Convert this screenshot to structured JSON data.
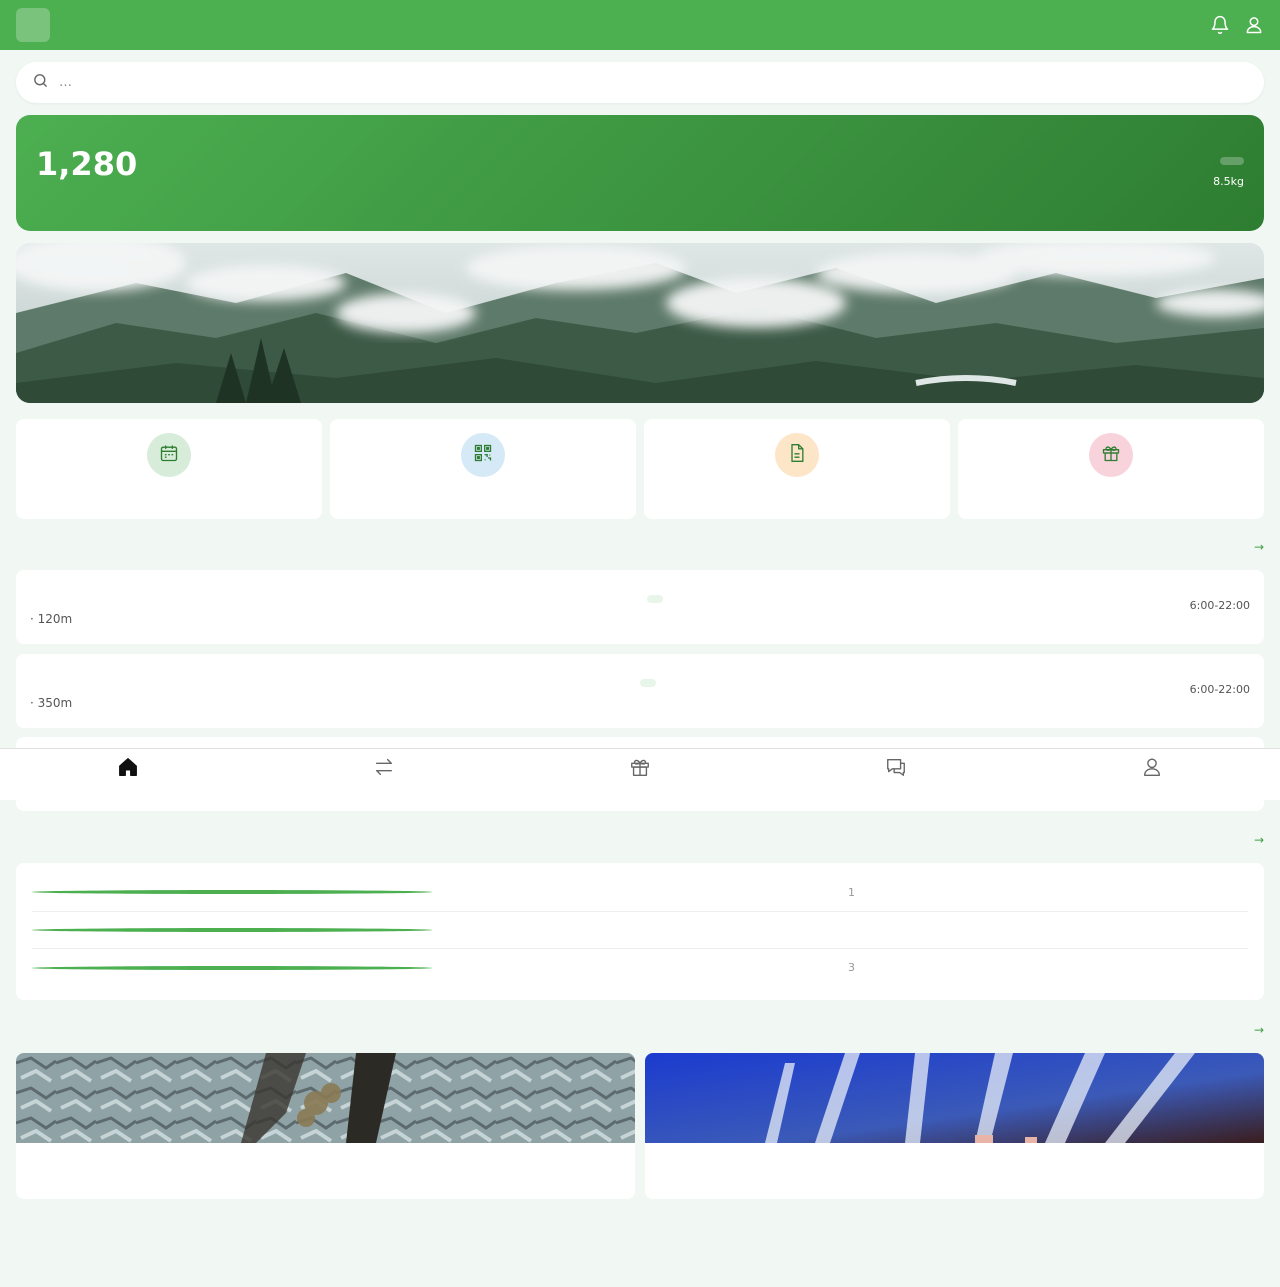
{
  "header": {
    "logo_glyph": "",
    "title": "",
    "bell_icon": "bell-icon",
    "user_icon": "user-icon"
  },
  "search": {
    "placeholder": "…"
  },
  "points": {
    "label": "",
    "value": "1,280",
    "unit": "",
    "level": "",
    "subtext": "8.5kg"
  },
  "quick": [
    {
      "label": "",
      "icon": "calendar-icon",
      "bg": "#d7ecd9",
      "color": "#2e7d32"
    },
    {
      "label": "",
      "icon": "qr-code-icon",
      "bg": "#d6e9f7",
      "color": "#2e7d32"
    },
    {
      "label": "",
      "icon": "document-icon",
      "bg": "#fde6c8",
      "color": "#2e7d32"
    },
    {
      "label": "",
      "icon": "gift-icon",
      "bg": "#f9d3dc",
      "color": "#2e7d32"
    }
  ],
  "stations": {
    "title": "",
    "more": " →",
    "items": [
      {
        "name": "",
        "address": " · 120m",
        "badge": "",
        "hours": "6:00-22:00"
      },
      {
        "name": "",
        "address": " · 350m",
        "badge": "",
        "hours": "6:00-22:00"
      }
    ]
  },
  "tabs": [
    {
      "label": "",
      "icon": "home-icon",
      "active": true
    },
    {
      "label": "",
      "icon": "exchange-icon",
      "active": false
    },
    {
      "label": "",
      "icon": "gift-icon",
      "active": false
    },
    {
      "label": "",
      "icon": "chat-icon",
      "active": false
    },
    {
      "label": "",
      "icon": "user-icon",
      "active": false
    }
  ],
  "news": {
    "title": "",
    "more": " →",
    "items": [
      {
        "text": "",
        "time": "1"
      },
      {
        "text": "",
        "time": ""
      },
      {
        "text": "",
        "time": "3"
      }
    ]
  },
  "activities": {
    "title": "",
    "more": " →",
    "items": [
      {
        "title": "",
        "subtitle": ""
      },
      {
        "title": "",
        "subtitle": ""
      }
    ]
  },
  "colors": {
    "primary": "#4caf50",
    "primary_dark": "#2e7d32",
    "text": "#1b5e20",
    "background": "#f1f7f2"
  }
}
